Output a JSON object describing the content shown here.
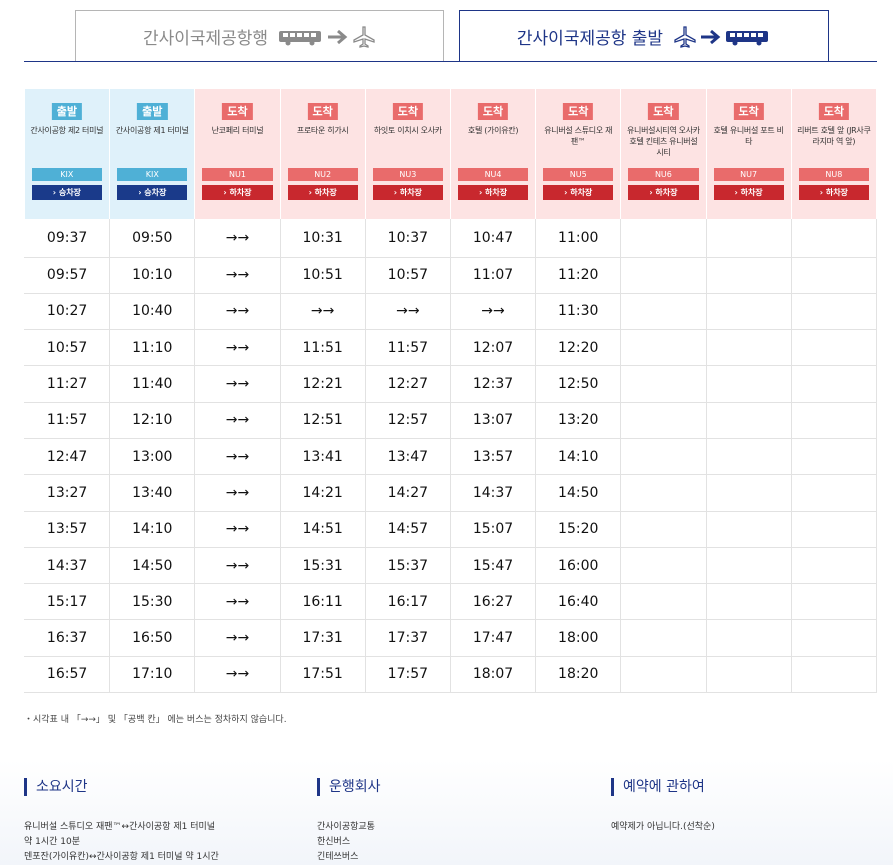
{
  "tabs": {
    "left_label": "간사이국제공항행",
    "right_label": "간사이국제공항 출발",
    "left_active": false,
    "right_active": true,
    "inactive_color": "#8a8a8a",
    "active_color": "#1e3587"
  },
  "stops": [
    {
      "kind": "출발",
      "name": "간사이공항 제2 터미널",
      "code": "KIX",
      "button": "› 승차장"
    },
    {
      "kind": "출발",
      "name": "간사이공항 제1 터미널",
      "code": "KIX",
      "button": "› 승차장"
    },
    {
      "kind": "도착",
      "name": "난코페리 터미널",
      "code": "NU1",
      "button": "› 하차장"
    },
    {
      "kind": "도착",
      "name": "프로타운 히가시",
      "code": "NU2",
      "button": "› 하차장"
    },
    {
      "kind": "도착",
      "name": "하잇토 이치시 오사카",
      "code": "NU3",
      "button": "› 하차장"
    },
    {
      "kind": "도착",
      "name": "호텔 (가이유칸)",
      "code": "NU4",
      "button": "› 하차장"
    },
    {
      "kind": "도착",
      "name": "유니버설 스튜디오 재팬™",
      "code": "NU5",
      "button": "› 하차장"
    },
    {
      "kind": "도착",
      "name": "유니버설시티역 오사카 호텔 킨테츠 유니버설시티",
      "code": "NU6",
      "button": "› 하차장"
    },
    {
      "kind": "도착",
      "name": "호텔 유니버설 포트 비타",
      "code": "NU7",
      "button": "› 하차장"
    },
    {
      "kind": "도착",
      "name": "리버트 호텔 앞 (JR사쿠라지마 역 앞)",
      "code": "NU8",
      "button": "› 하차장"
    }
  ],
  "rows": [
    [
      "09:37",
      "09:50",
      "→→",
      "10:31",
      "10:37",
      "10:47",
      "11:00",
      "",
      "",
      ""
    ],
    [
      "09:57",
      "10:10",
      "→→",
      "10:51",
      "10:57",
      "11:07",
      "11:20",
      "",
      "",
      ""
    ],
    [
      "10:27",
      "10:40",
      "→→",
      "→→",
      "→→",
      "→→",
      "11:30",
      "",
      "",
      ""
    ],
    [
      "10:57",
      "11:10",
      "→→",
      "11:51",
      "11:57",
      "12:07",
      "12:20",
      "",
      "",
      ""
    ],
    [
      "11:27",
      "11:40",
      "→→",
      "12:21",
      "12:27",
      "12:37",
      "12:50",
      "",
      "",
      ""
    ],
    [
      "11:57",
      "12:10",
      "→→",
      "12:51",
      "12:57",
      "13:07",
      "13:20",
      "",
      "",
      ""
    ],
    [
      "12:47",
      "13:00",
      "→→",
      "13:41",
      "13:47",
      "13:57",
      "14:10",
      "",
      "",
      ""
    ],
    [
      "13:27",
      "13:40",
      "→→",
      "14:21",
      "14:27",
      "14:37",
      "14:50",
      "",
      "",
      ""
    ],
    [
      "13:57",
      "14:10",
      "→→",
      "14:51",
      "14:57",
      "15:07",
      "15:20",
      "",
      "",
      ""
    ],
    [
      "14:37",
      "14:50",
      "→→",
      "15:31",
      "15:37",
      "15:47",
      "16:00",
      "",
      "",
      ""
    ],
    [
      "15:17",
      "15:30",
      "→→",
      "16:11",
      "16:17",
      "16:27",
      "16:40",
      "",
      "",
      ""
    ],
    [
      "16:37",
      "16:50",
      "→→",
      "17:31",
      "17:37",
      "17:47",
      "18:00",
      "",
      "",
      ""
    ],
    [
      "16:57",
      "17:10",
      "→→",
      "17:51",
      "17:57",
      "18:07",
      "18:20",
      "",
      "",
      ""
    ]
  ],
  "note": "・시각표 내 「→→」 및 「공백 칸」 에는 버스는 정차하지 않습니다.",
  "info": {
    "duration": {
      "heading": "소요시간",
      "lines": [
        "유니버설 스튜디오 재팬™↔간사이공항 제1 터미널",
        "약 1시간 10분",
        "덴포잔(가이유칸)↔간사이공항 제1 터미널   약 1시간"
      ]
    },
    "operators": {
      "heading": "운행회사",
      "lines": [
        "간사이공항교통",
        "한신버스",
        "긴테쓰버스"
      ]
    },
    "reservation": {
      "heading": "예약에 관하여",
      "lines": [
        "예약제가 아닙니다.(선착순)"
      ]
    }
  },
  "colors": {
    "departure_bg": "#dff1fa",
    "departure_accent": "#4fb0d6",
    "departure_button": "#1a3a8a",
    "arrival_bg": "#fde3e3",
    "arrival_accent": "#e96b6b",
    "arrival_button": "#c8282e",
    "brand": "#1e3587"
  }
}
